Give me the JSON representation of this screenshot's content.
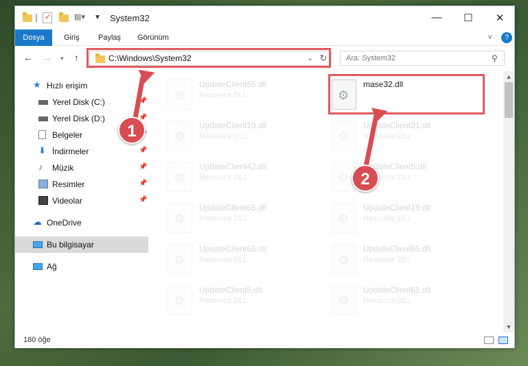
{
  "window": {
    "title": "System32",
    "minimize_icon": "minimize-icon",
    "maximize_icon": "maximize-icon",
    "close_icon": "close-icon"
  },
  "ribbon": {
    "tabs": [
      "Dosya",
      "Giriş",
      "Paylaş",
      "Görünüm"
    ],
    "accent": "#1979ca"
  },
  "address": {
    "path": "C:\\Windows\\System32",
    "search_placeholder": "Ara: System32"
  },
  "sidebar": {
    "items": [
      {
        "label": "Hızlı erişim",
        "icon": "star-icon",
        "pinned": false
      },
      {
        "label": "Yerel Disk (C:)",
        "icon": "drive-icon",
        "pinned": true
      },
      {
        "label": "Yerel Disk (D:)",
        "icon": "drive-icon",
        "pinned": true
      },
      {
        "label": "Belgeler",
        "icon": "documents-icon",
        "pinned": true
      },
      {
        "label": "İndirmeler",
        "icon": "download-icon",
        "pinned": true
      },
      {
        "label": "Müzik",
        "icon": "music-icon",
        "pinned": true
      },
      {
        "label": "Resimler",
        "icon": "pictures-icon",
        "pinned": true
      },
      {
        "label": "Videolar",
        "icon": "video-icon",
        "pinned": true
      },
      {
        "label": "OneDrive",
        "icon": "cloud-icon",
        "pinned": false
      },
      {
        "label": "Bu bilgisayar",
        "icon": "computer-icon",
        "pinned": false
      },
      {
        "label": "Ağ",
        "icon": "network-icon",
        "pinned": false
      }
    ]
  },
  "files": {
    "highlighted": {
      "name": "mase32.dll",
      "type": ""
    },
    "left_column": [
      {
        "name": "UpdateClient65.dll",
        "type": "Resource DLL"
      },
      {
        "name": "UpdateClient19.dll",
        "type": "Resource DLL"
      },
      {
        "name": "UpdateClient42.dll",
        "type": "Resource DLL"
      },
      {
        "name": "UpdateClient65.dll",
        "type": "Resource DLL"
      },
      {
        "name": "UpdateClient65.dll",
        "type": "Resource DLL"
      },
      {
        "name": "UpdateClient5.dll",
        "type": "Resource DLL"
      }
    ],
    "right_column": [
      {
        "name": "UpdateClient21.dll",
        "type": "Resource DLL"
      },
      {
        "name": "UpdateClient5.dll",
        "type": "Resource DLL"
      },
      {
        "name": "UpdateClient19.dll",
        "type": "Resource DLL"
      },
      {
        "name": "UpdateClient65.dll",
        "type": "Resource DLL"
      },
      {
        "name": "UpdateClient65.dll",
        "type": "Resource DLL"
      }
    ]
  },
  "status": {
    "count": "180 öğe"
  },
  "annotations": {
    "marker1": "1",
    "marker2": "2",
    "color": "#d94c52"
  }
}
